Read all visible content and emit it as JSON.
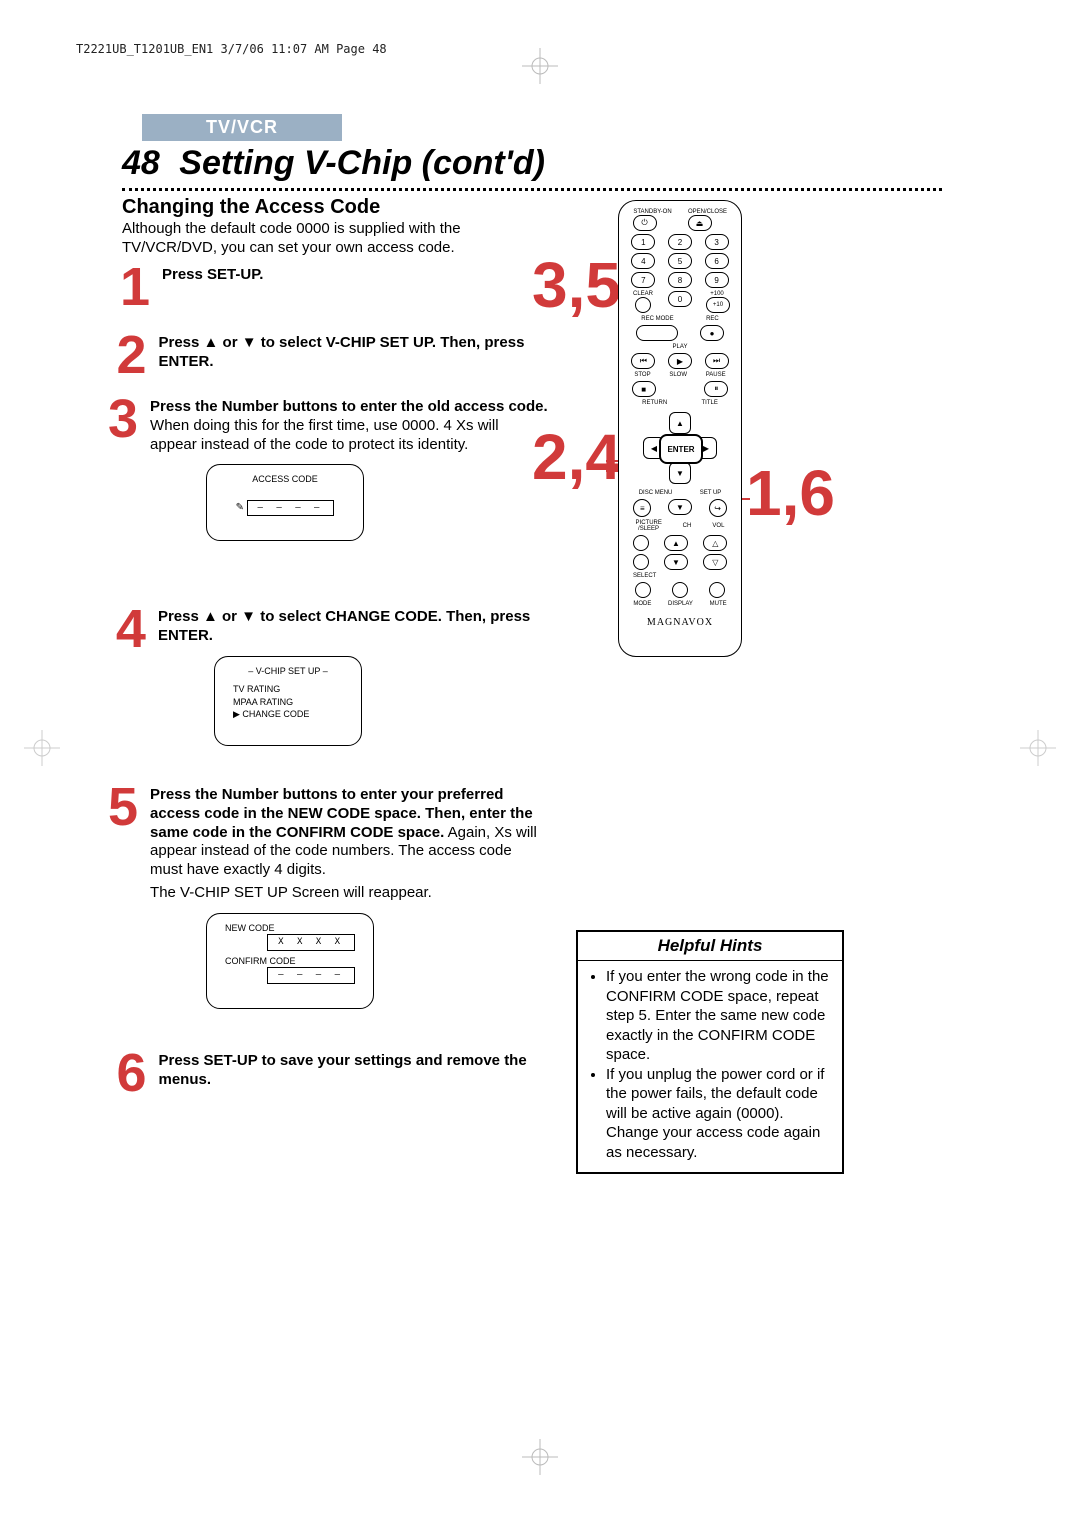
{
  "pageHeaderLine": "T2221UB_T1201UB_EN1  3/7/06  11:07 AM  Page 48",
  "badge": "TV/VCR",
  "pageNumber": "48",
  "pageTitle": "Setting V-Chip (cont'd)",
  "sectionHeading": "Changing the Access Code",
  "intro": "Although the default code 0000 is supplied with the TV/VCR/DVD, you can set your own access code.",
  "steps": {
    "s1": {
      "num": "1",
      "bold": "Press SET-UP.",
      "rest": ""
    },
    "s2": {
      "num": "2",
      "bold": "Press ▲ or ▼ to select V-CHIP SET UP. Then, press ENTER.",
      "rest": ""
    },
    "s3": {
      "num": "3",
      "bold": "Press the Number buttons to enter the old access code.",
      "rest": " When doing this for the first time, use 0000. 4 Xs will appear instead of the code to protect its identity."
    },
    "s4": {
      "num": "4",
      "bold": "Press ▲ or ▼ to select CHANGE CODE. Then, press ENTER.",
      "rest": ""
    },
    "s5": {
      "num": "5",
      "bold": "Press the Number buttons to enter your preferred access code in the NEW CODE space. Then, enter the same code in the CONFIRM CODE space.",
      "rest": " Again, Xs will appear instead of the code numbers. The access code must have exactly 4 digits.",
      "extra": "The V-CHIP SET UP Screen will reappear."
    },
    "s6": {
      "num": "6",
      "bold": "Press SET-UP to save your settings and remove the menus.",
      "rest": ""
    }
  },
  "osd1": {
    "title": "ACCESS CODE",
    "value": "– – – –"
  },
  "osd2": {
    "title": "– V-CHIP SET UP –",
    "items": [
      "TV RATING",
      "MPAA RATING",
      "▶ CHANGE CODE"
    ]
  },
  "osd3": {
    "new": "NEW CODE",
    "newVal": "X X X X",
    "confirm": "CONFIRM CODE",
    "confirmVal": "– – – –"
  },
  "callouts": {
    "c35": "3,5",
    "c24": "2,4",
    "c16": "1,6"
  },
  "remote": {
    "labels": {
      "standby": "STANDBY-ON",
      "openclose": "OPEN/CLOSE",
      "clear": "CLEAR",
      "plus100": "+100",
      "plus10": "+10",
      "recmode": "REC MODE",
      "rec": "REC",
      "play": "PLAY",
      "stop": "STOP",
      "slow": "SLOW",
      "pause": "PAUSE",
      "return": "RETURN",
      "title": "TITLE",
      "enter": "ENTER",
      "disc": "DISC MENU",
      "setup": "SET UP",
      "picture": "PICTURE /SLEEP",
      "ch": "CH",
      "vol": "VOL",
      "select": "SELECT",
      "mode": "MODE",
      "display": "DISPLAY",
      "mute": "MUTE"
    },
    "numbers": [
      "1",
      "2",
      "3",
      "4",
      "5",
      "6",
      "7",
      "8",
      "9",
      "0"
    ],
    "brand": "MAGNAVOX"
  },
  "hints": {
    "title": "Helpful Hints",
    "items": [
      "If you enter the wrong code in the CONFIRM CODE space, repeat step 5. Enter the same new code exactly in the CONFIRM CODE space.",
      "If you unplug the power cord or if the power fails, the default code will be active again (0000). Change your access code again as necessary."
    ]
  }
}
